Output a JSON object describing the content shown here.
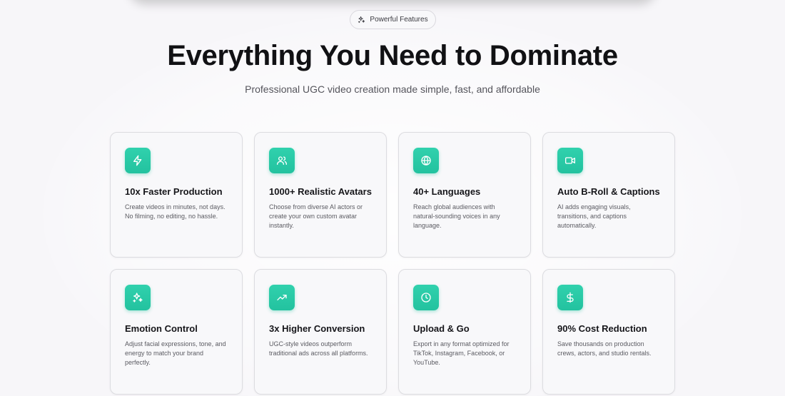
{
  "badge": {
    "label": "Powerful Features",
    "icon": "sparkles-icon"
  },
  "hero": {
    "title": "Everything You Need to Dominate",
    "subtitle": "Professional UGC video creation made simple, fast, and affordable"
  },
  "colors": {
    "accent": "#2ac8a5",
    "background": "#f7f6f9",
    "card": "#f8f8fa"
  },
  "features": [
    {
      "icon": "lightning-icon",
      "title": "10x Faster Production",
      "description": "Create videos in minutes, not days. No filming, no editing, no hassle."
    },
    {
      "icon": "users-icon",
      "title": "1000+ Realistic Avatars",
      "description": "Choose from diverse AI actors or create your own custom avatar instantly."
    },
    {
      "icon": "globe-icon",
      "title": "40+ Languages",
      "description": "Reach global audiences with natural-sounding voices in any language."
    },
    {
      "icon": "video-camera-icon",
      "title": "Auto B-Roll & Captions",
      "description": "AI adds engaging visuals, transitions, and captions automatically."
    },
    {
      "icon": "sparkles-icon",
      "title": "Emotion Control",
      "description": "Adjust facial expressions, tone, and energy to match your brand perfectly."
    },
    {
      "icon": "trending-up-icon",
      "title": "3x Higher Conversion",
      "description": "UGC-style videos outperform traditional ads across all platforms."
    },
    {
      "icon": "clock-icon",
      "title": "Upload & Go",
      "description": "Export in any format optimized for TikTok, Instagram, Facebook, or YouTube."
    },
    {
      "icon": "dollar-icon",
      "title": "90% Cost Reduction",
      "description": "Save thousands on production crews, actors, and studio rentals."
    }
  ]
}
